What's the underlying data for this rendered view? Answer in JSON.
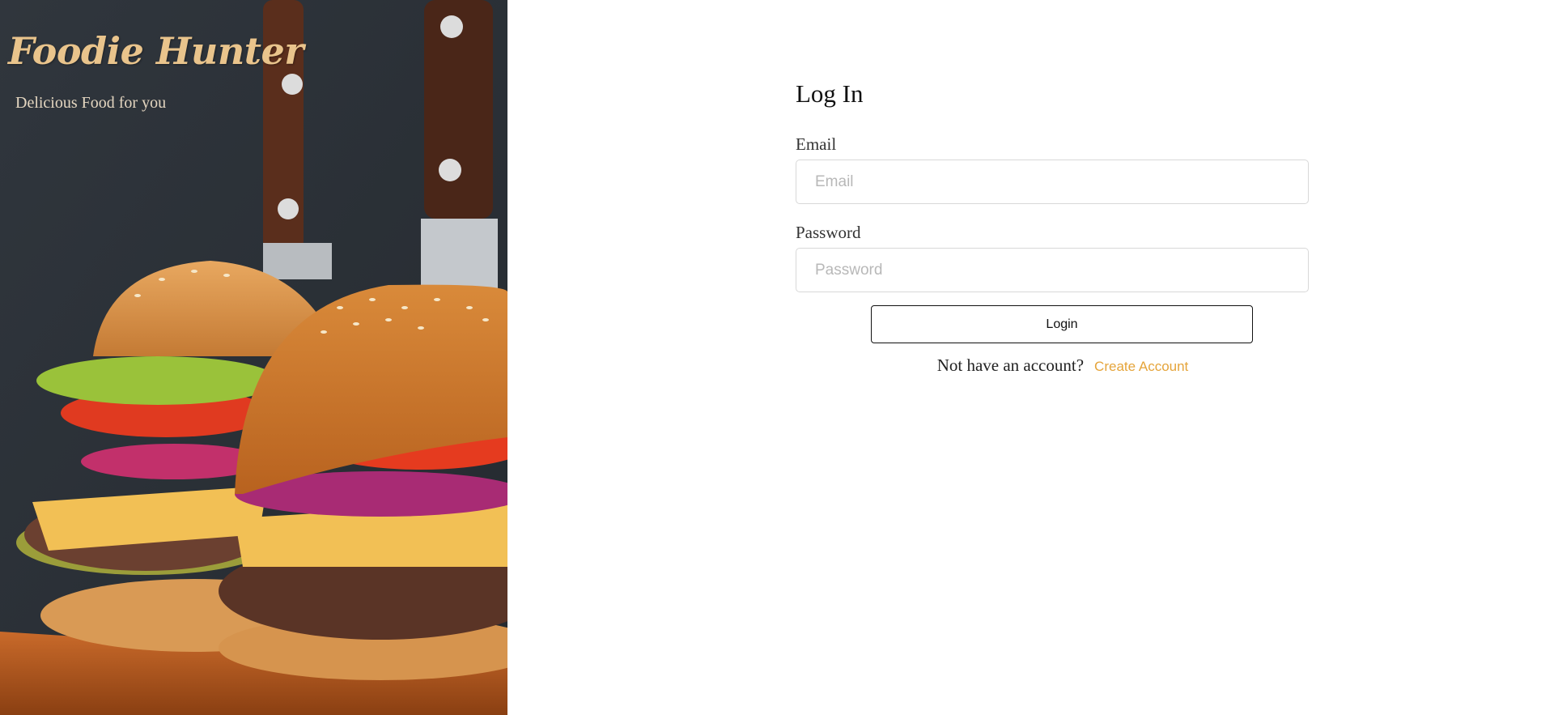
{
  "brand": {
    "name": "Foodie Hunter",
    "tagline": "Delicious Food for you"
  },
  "hero": {
    "image_subject": "burgers-with-knives-photo"
  },
  "login_form": {
    "title": "Log In",
    "email_label": "Email",
    "email_placeholder": "Email",
    "email_value": "",
    "password_label": "Password",
    "password_placeholder": "Password",
    "password_value": "",
    "submit_label": "Login",
    "signup_prompt": "Not have an account?",
    "signup_link": "Create Account"
  },
  "colors": {
    "brand_gold": "#e9c48c",
    "link_orange": "#e5a43a",
    "hero_background": "#343a41"
  }
}
